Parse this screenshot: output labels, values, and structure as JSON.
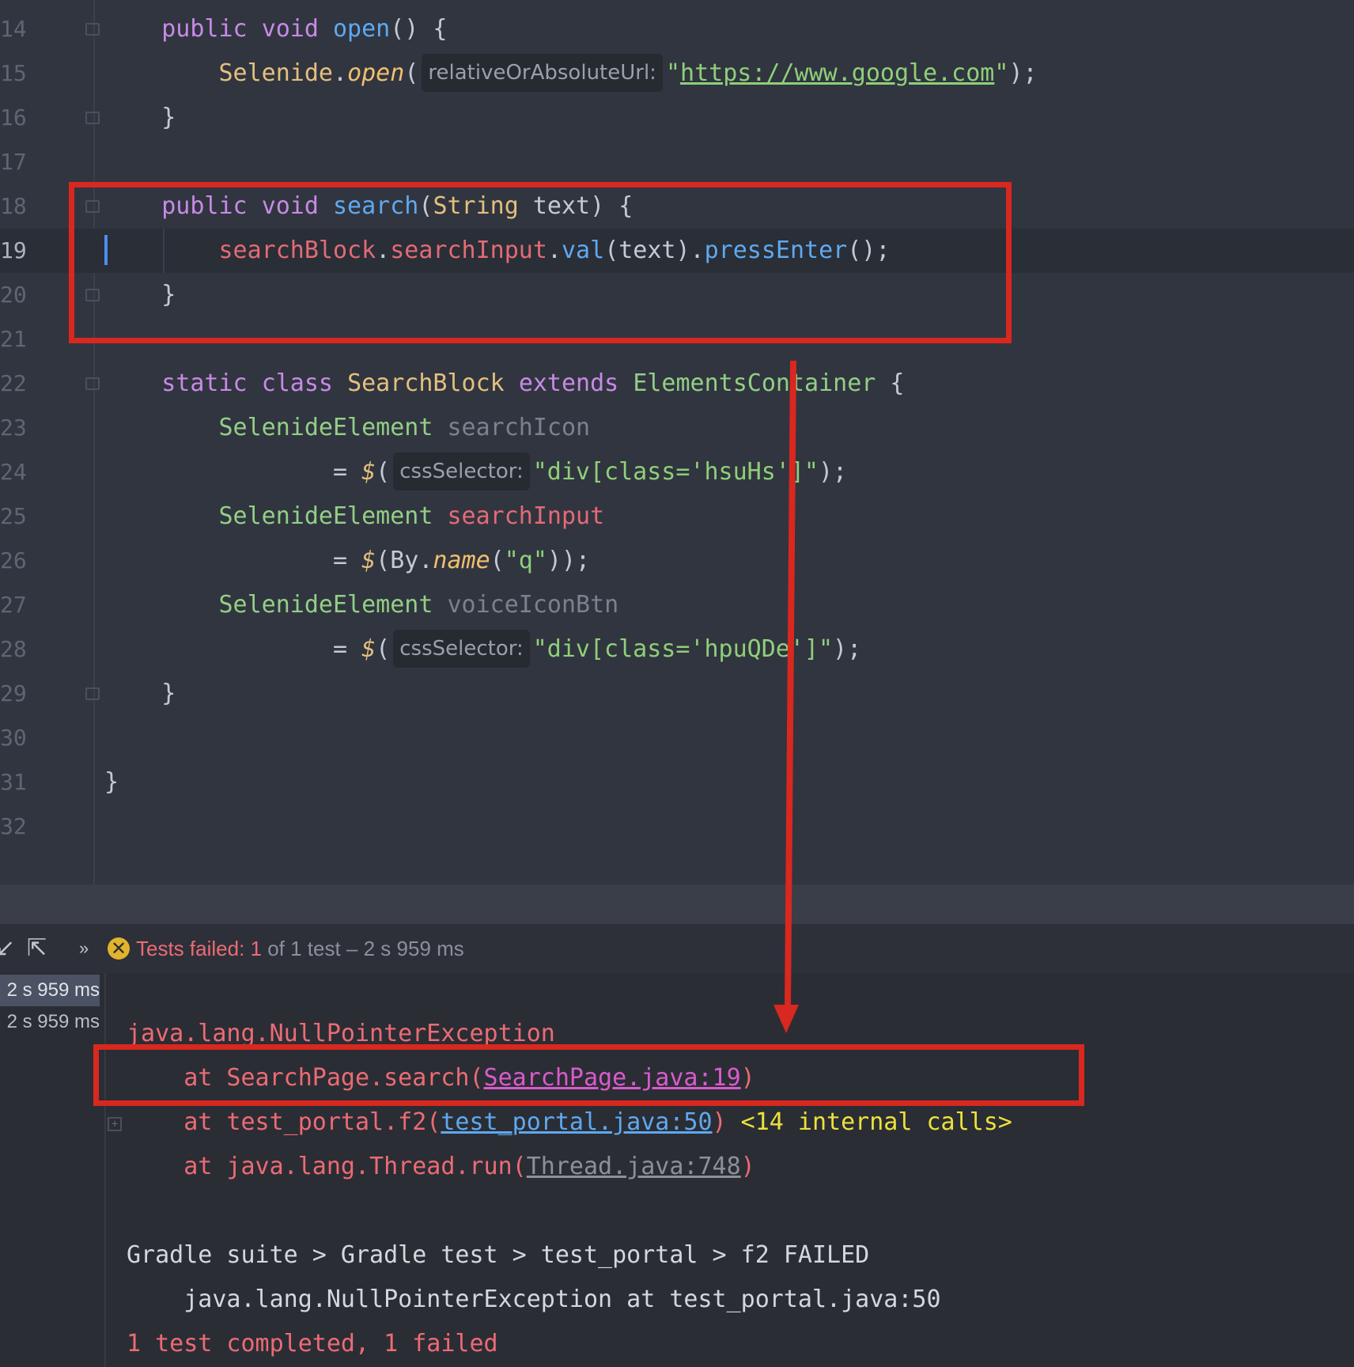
{
  "editor": {
    "lines": [
      {
        "num": "14",
        "parts": [
          {
            "t": "    "
          },
          {
            "t": "public ",
            "c": "kw"
          },
          {
            "t": "void ",
            "c": "kw"
          },
          {
            "t": "open",
            "c": "fn"
          },
          {
            "t": "() {"
          }
        ]
      },
      {
        "num": "15",
        "parts": [
          {
            "t": "        "
          },
          {
            "t": "Selenide",
            "c": "ty"
          },
          {
            "t": "."
          },
          {
            "t": "open",
            "c": "it"
          },
          {
            "t": "("
          },
          {
            "hint": "relativeOrAbsoluteUrl:"
          },
          {
            "t": "\"",
            "c": "str"
          },
          {
            "t": "https://www.google.com",
            "c": "url"
          },
          {
            "t": "\"",
            "c": "str"
          },
          {
            "t": ");"
          }
        ]
      },
      {
        "num": "16",
        "parts": [
          {
            "t": "    }"
          }
        ]
      },
      {
        "num": "17",
        "parts": []
      },
      {
        "num": "18",
        "parts": [
          {
            "t": "    "
          },
          {
            "t": "public ",
            "c": "kw"
          },
          {
            "t": "void ",
            "c": "kw"
          },
          {
            "t": "search",
            "c": "fn"
          },
          {
            "t": "("
          },
          {
            "t": "String",
            "c": "ty"
          },
          {
            "t": " text) {"
          }
        ]
      },
      {
        "num": "19",
        "parts": [
          {
            "t": "        "
          },
          {
            "t": "searchBlock",
            "c": "fld"
          },
          {
            "t": "."
          },
          {
            "t": "searchInput",
            "c": "fld"
          },
          {
            "t": "."
          },
          {
            "t": "val",
            "c": "fn"
          },
          {
            "t": "(text)."
          },
          {
            "t": "pressEnter",
            "c": "fn"
          },
          {
            "t": "();"
          }
        ]
      },
      {
        "num": "20",
        "parts": [
          {
            "t": "    }"
          }
        ]
      },
      {
        "num": "21",
        "parts": []
      },
      {
        "num": "22",
        "parts": [
          {
            "t": "    "
          },
          {
            "t": "static ",
            "c": "kw"
          },
          {
            "t": "class ",
            "c": "kw"
          },
          {
            "t": "SearchBlock ",
            "c": "ty"
          },
          {
            "t": "extends ",
            "c": "kw"
          },
          {
            "t": "ElementsContainer",
            "c": "cls"
          },
          {
            "t": " {"
          }
        ]
      },
      {
        "num": "23",
        "parts": [
          {
            "t": "        "
          },
          {
            "t": "SelenideElement ",
            "c": "cls"
          },
          {
            "t": "searchIcon",
            "c": "gray"
          }
        ]
      },
      {
        "num": "24",
        "parts": [
          {
            "t": "                = "
          },
          {
            "t": "$",
            "c": "dl"
          },
          {
            "t": "("
          },
          {
            "hint": "cssSelector:"
          },
          {
            "t": "\"div[class='hsuHs']\"",
            "c": "str"
          },
          {
            "t": ");"
          }
        ]
      },
      {
        "num": "25",
        "parts": [
          {
            "t": "        "
          },
          {
            "t": "SelenideElement ",
            "c": "cls"
          },
          {
            "t": "searchInput",
            "c": "fld"
          }
        ]
      },
      {
        "num": "26",
        "parts": [
          {
            "t": "                = "
          },
          {
            "t": "$",
            "c": "dl"
          },
          {
            "t": "(By."
          },
          {
            "t": "name",
            "c": "it"
          },
          {
            "t": "("
          },
          {
            "t": "\"q\"",
            "c": "str"
          },
          {
            "t": "));"
          }
        ]
      },
      {
        "num": "27",
        "parts": [
          {
            "t": "        "
          },
          {
            "t": "SelenideElement ",
            "c": "cls"
          },
          {
            "t": "voiceIconBtn",
            "c": "gray"
          }
        ]
      },
      {
        "num": "28",
        "parts": [
          {
            "t": "                = "
          },
          {
            "t": "$",
            "c": "dl"
          },
          {
            "t": "("
          },
          {
            "hint": "cssSelector:"
          },
          {
            "t": "\"div[class='hpuQDe']\"",
            "c": "str"
          },
          {
            "t": ");"
          }
        ]
      },
      {
        "num": "29",
        "parts": [
          {
            "t": "    }"
          }
        ]
      },
      {
        "num": "30",
        "parts": []
      },
      {
        "num": "31",
        "parts": [
          {
            "t": "}"
          }
        ]
      },
      {
        "num": "32",
        "parts": []
      }
    ]
  },
  "run": {
    "status_prefix": "Tests failed: ",
    "status_count": "1",
    "status_suffix": " of 1 test – 2 s 959 ms",
    "tree": [
      "2 s 959 ms",
      "2 s 959 ms"
    ]
  },
  "output": [
    {
      "parts": [
        {
          "t": "java.lang.NullPointerException",
          "c": "red"
        }
      ]
    },
    {
      "parts": [
        {
          "t": "    at SearchPage.search(",
          "c": "red"
        },
        {
          "t": "SearchPage.java:19",
          "c": "link-red"
        },
        {
          "t": ")",
          "c": "red"
        }
      ]
    },
    {
      "parts": [
        {
          "t": "    at test_portal.f2(",
          "c": "red"
        },
        {
          "t": "test_portal.java:50",
          "c": "link-blue"
        },
        {
          "t": ") ",
          "c": "red"
        },
        {
          "t": "<14 internal calls>",
          "c": "yellow"
        }
      ]
    },
    {
      "parts": [
        {
          "t": "    at java.lang.Thread.run(",
          "c": "red"
        },
        {
          "t": "Thread.java:748",
          "c": "link-gray"
        },
        {
          "t": ")",
          "c": "red"
        }
      ]
    },
    {
      "parts": []
    },
    {
      "parts": [
        {
          "t": "Gradle suite > Gradle test > test_portal > f2 FAILED",
          "c": "white"
        }
      ]
    },
    {
      "parts": [
        {
          "t": "    java.lang.NullPointerException at test_portal.java:50",
          "c": "white"
        }
      ]
    },
    {
      "parts": [
        {
          "t": "1 test completed, 1 failed",
          "c": "red"
        }
      ]
    }
  ],
  "colors": {
    "annotation_red": "#d8281f"
  }
}
